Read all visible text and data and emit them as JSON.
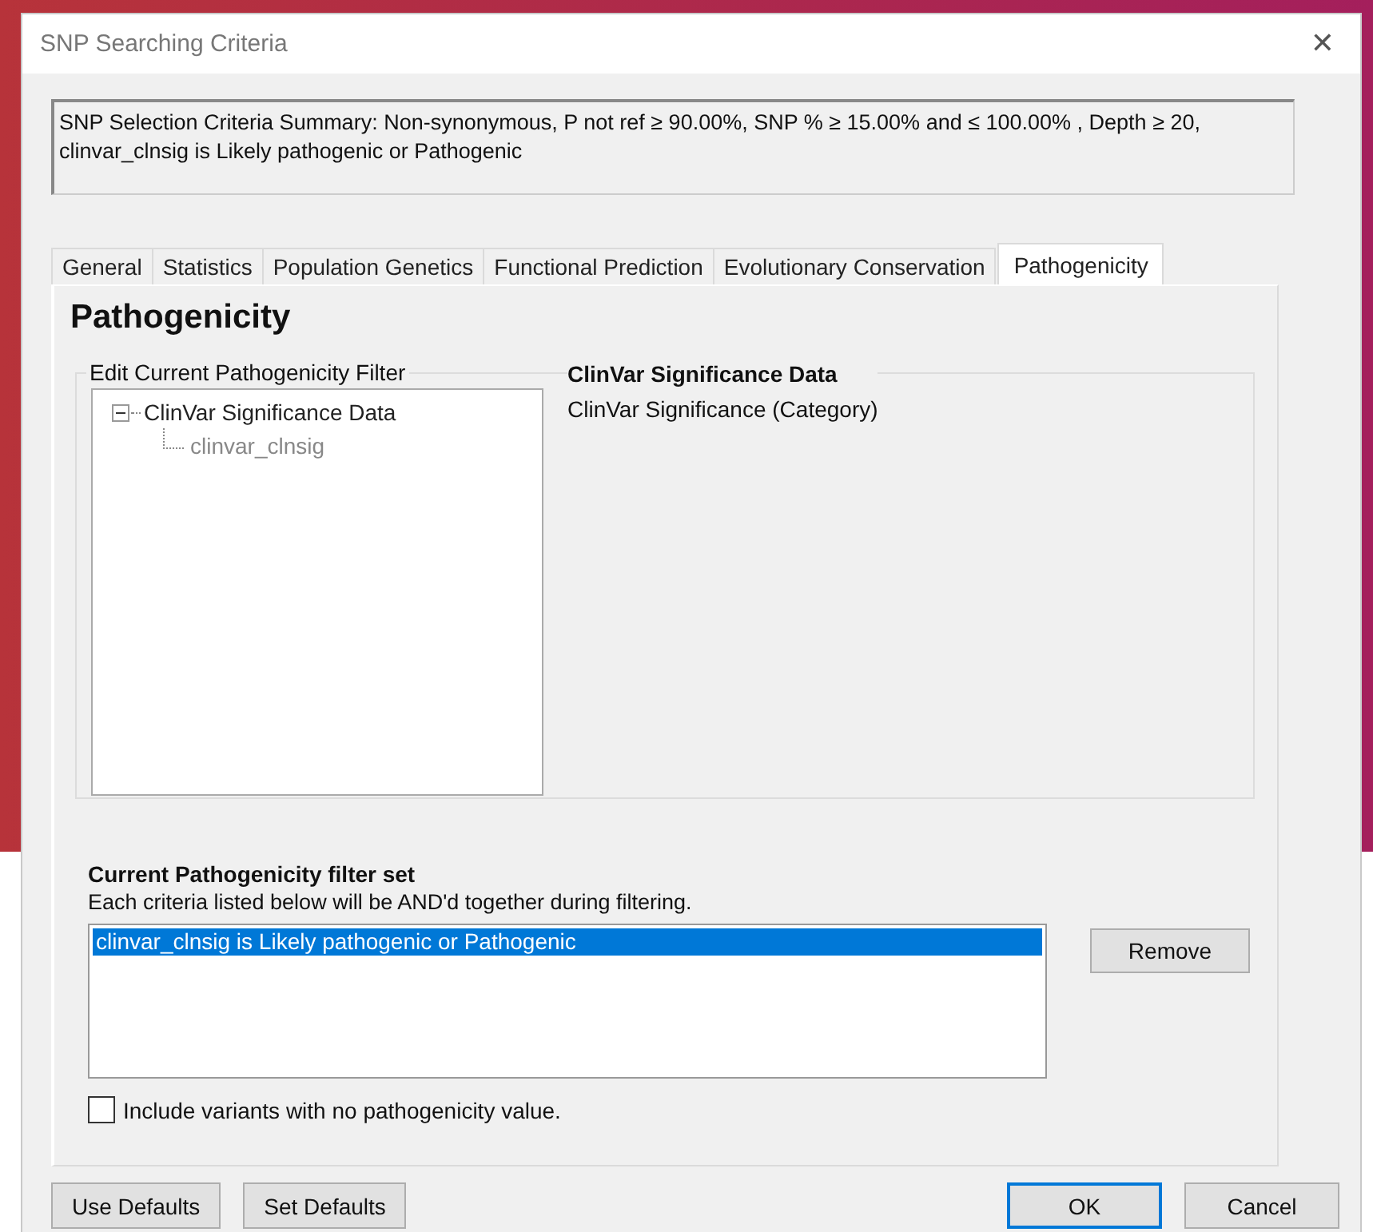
{
  "window": {
    "title": "SNP Searching Criteria",
    "close": "✕"
  },
  "summary": "SNP Selection Criteria Summary: Non-synonymous, P not ref ≥ 90.00%, SNP % ≥ 15.00% and ≤ 100.00% , Depth ≥ 20, clinvar_clnsig is Likely pathogenic or Pathogenic",
  "tabs": [
    {
      "label": "General",
      "selected": false
    },
    {
      "label": "Statistics",
      "selected": false
    },
    {
      "label": "Population Genetics",
      "selected": false
    },
    {
      "label": "Functional Prediction",
      "selected": false
    },
    {
      "label": "Evolutionary Conservation",
      "selected": false
    },
    {
      "label": "Pathogenicity",
      "selected": true
    }
  ],
  "panel": {
    "heading": "Pathogenicity",
    "group_label": "Edit Current Pathogenicity Filter",
    "tree": [
      {
        "label": "ClinVar Significance Data",
        "expanded": true,
        "disabled": false,
        "children": [
          {
            "label": "clinvar_clnsig",
            "disabled": true
          }
        ]
      }
    ],
    "detail_title": "ClinVar Significance Data",
    "detail_text": "ClinVar Significance (Category)",
    "filter_set_heading": "Current Pathogenicity filter set",
    "filter_set_note": "Each criteria listed below will be AND'd together during filtering.",
    "filters": [
      {
        "label": "clinvar_clnsig is Likely pathogenic or Pathogenic",
        "selected": true
      }
    ],
    "remove_button": "Remove",
    "include_checkbox": {
      "label": "Include variants with no pathogenicity value.",
      "checked": false
    }
  },
  "buttons": [
    {
      "label": "Use Defaults",
      "kind": "plain"
    },
    {
      "label": "Set Defaults",
      "kind": "plain"
    },
    {
      "label": "OK",
      "kind": "default"
    },
    {
      "label": "Cancel",
      "kind": "plain"
    }
  ]
}
